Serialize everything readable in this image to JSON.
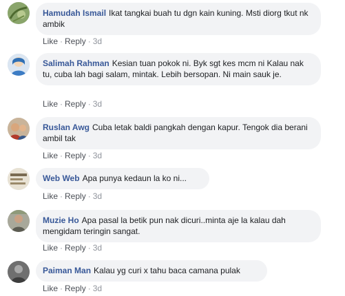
{
  "comments": [
    {
      "author": "Hamudah Ismail",
      "text": "Ikat tangkai buah tu dgn kain kuning. Msti diorg tkut nk ambik",
      "like": "Like",
      "reply": "Reply",
      "time": "3d",
      "avatar_icon": "avatar-hamudah-ismail-icon"
    },
    {
      "author": "Salimah Rahman",
      "text": "Kesian tuan pokok ni. Byk sgt kes mcm ni Kalau nak tu, cuba lah bagi salam, mintak. Lebih bersopan. Ni main sauk je.",
      "like": "Like",
      "reply": "Reply",
      "time": "3d",
      "avatar_icon": "avatar-salimah-rahman-icon"
    },
    {
      "author": "Ruslan Awg",
      "text": "Cuba letak baldi pangkah dengan kapur. Tengok dia berani ambil tak",
      "like": "Like",
      "reply": "Reply",
      "time": "3d",
      "avatar_icon": "avatar-ruslan-awg-icon"
    },
    {
      "author": "Web Web",
      "text": "Apa punya kedaun la ko ni...",
      "like": "Like",
      "reply": "Reply",
      "time": "3d",
      "avatar_icon": "avatar-web-web-icon"
    },
    {
      "author": "Muzie Ho",
      "text": "Apa pasal la betik pun nak dicuri..minta aje la kalau dah mengidam teringin sangat.",
      "like": "Like",
      "reply": "Reply",
      "time": "3d",
      "avatar_icon": "avatar-muzie-ho-icon"
    },
    {
      "author": "Paiman Man",
      "text": "Kalau yg curi x tahu baca camana pulak",
      "like": "Like",
      "reply": "Reply",
      "time": "3d",
      "avatar_icon": "avatar-paiman-man-icon"
    }
  ],
  "dot": "·",
  "colors": {
    "author": "#385898",
    "bubble": "#f2f3f5",
    "action": "#4b4f56",
    "meta": "#90949c"
  }
}
